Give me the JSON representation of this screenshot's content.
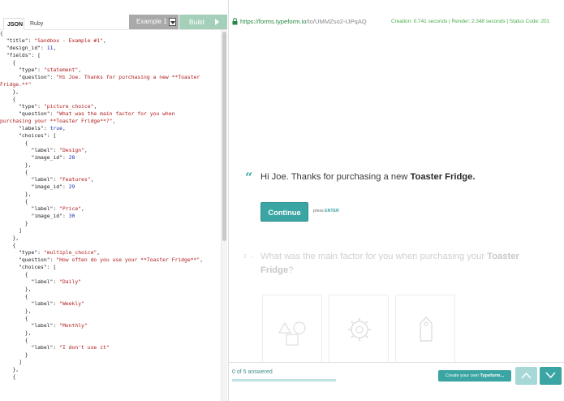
{
  "editor": {
    "tabs": [
      {
        "label": "JSON",
        "active": true
      },
      {
        "label": "Ruby",
        "active": false
      }
    ],
    "example_select": "Example 1",
    "build_label": "Build",
    "code_lines": [
      [
        [
          "k",
          "{"
        ]
      ],
      [
        [
          "k",
          "  \"title\": "
        ],
        [
          "s",
          "\"Sandbox - Example #1\""
        ],
        [
          "k",
          ","
        ]
      ],
      [
        [
          "k",
          "  \"design_id\": "
        ],
        [
          "n",
          "11"
        ],
        [
          "k",
          ","
        ]
      ],
      [
        [
          "k",
          "  \"fields\": ["
        ]
      ],
      [
        [
          "k",
          "    {"
        ]
      ],
      [
        [
          "k",
          "      \"type\": "
        ],
        [
          "s",
          "\"statement\""
        ],
        [
          "k",
          ","
        ]
      ],
      [
        [
          "k",
          "      \"question\": "
        ],
        [
          "s",
          "\"Hi Joe. Thanks for purchasing a new **Toaster"
        ]
      ],
      [
        [
          "s",
          "Fridge.**\""
        ]
      ],
      [
        [
          "k",
          "    },"
        ]
      ],
      [
        [
          "k",
          "    {"
        ]
      ],
      [
        [
          "k",
          "      \"type\": "
        ],
        [
          "s",
          "\"picture_choice\""
        ],
        [
          "k",
          ","
        ]
      ],
      [
        [
          "k",
          "      \"question\": "
        ],
        [
          "s",
          "\"What was the main factor for you when"
        ]
      ],
      [
        [
          "s",
          "purchasing your **Toaster Fridge**?\""
        ],
        [
          "k",
          ","
        ]
      ],
      [
        [
          "k",
          "      \"labels\": "
        ],
        [
          "n",
          "true"
        ],
        [
          "k",
          ","
        ]
      ],
      [
        [
          "k",
          "      \"choices\": ["
        ]
      ],
      [
        [
          "k",
          "        {"
        ]
      ],
      [
        [
          "k",
          "          \"label\": "
        ],
        [
          "s",
          "\"Design\""
        ],
        [
          "k",
          ","
        ]
      ],
      [
        [
          "k",
          "          \"image_id\": "
        ],
        [
          "n",
          "28"
        ]
      ],
      [
        [
          "k",
          "        },"
        ]
      ],
      [
        [
          "k",
          "        {"
        ]
      ],
      [
        [
          "k",
          "          \"label\": "
        ],
        [
          "s",
          "\"Features\""
        ],
        [
          "k",
          ","
        ]
      ],
      [
        [
          "k",
          "          \"image_id\": "
        ],
        [
          "n",
          "29"
        ]
      ],
      [
        [
          "k",
          "        },"
        ]
      ],
      [
        [
          "k",
          "        {"
        ]
      ],
      [
        [
          "k",
          "          \"label\": "
        ],
        [
          "s",
          "\"Price\""
        ],
        [
          "k",
          ","
        ]
      ],
      [
        [
          "k",
          "          \"image_id\": "
        ],
        [
          "n",
          "30"
        ]
      ],
      [
        [
          "k",
          "        }"
        ]
      ],
      [
        [
          "k",
          "      ]"
        ]
      ],
      [
        [
          "k",
          "    },"
        ]
      ],
      [
        [
          "k",
          "    {"
        ]
      ],
      [
        [
          "k",
          "      \"type\": "
        ],
        [
          "s",
          "\"multiple_choice\""
        ],
        [
          "k",
          ","
        ]
      ],
      [
        [
          "k",
          "      \"question\": "
        ],
        [
          "s",
          "\"How often do you use your **Toaster Fridge**\""
        ],
        [
          "k",
          ","
        ]
      ],
      [
        [
          "k",
          "      \"choices\": ["
        ]
      ],
      [
        [
          "k",
          "        {"
        ]
      ],
      [
        [
          "k",
          "          \"label\": "
        ],
        [
          "s",
          "\"Daily\""
        ]
      ],
      [
        [
          "k",
          "        },"
        ]
      ],
      [
        [
          "k",
          "        {"
        ]
      ],
      [
        [
          "k",
          "          \"label\": "
        ],
        [
          "s",
          "\"Weekly\""
        ]
      ],
      [
        [
          "k",
          "        },"
        ]
      ],
      [
        [
          "k",
          "        {"
        ]
      ],
      [
        [
          "k",
          "          \"label\": "
        ],
        [
          "s",
          "\"Monthly\""
        ]
      ],
      [
        [
          "k",
          "        },"
        ]
      ],
      [
        [
          "k",
          "        {"
        ]
      ],
      [
        [
          "k",
          "          \"label\": "
        ],
        [
          "s",
          "\"I don't use it\""
        ]
      ],
      [
        [
          "k",
          "        }"
        ]
      ],
      [
        [
          "k",
          "      ]"
        ]
      ],
      [
        [
          "k",
          "    },"
        ]
      ],
      [
        [
          "k",
          "    {"
        ]
      ]
    ]
  },
  "preview": {
    "url_scheme": "https://",
    "url_host": "forms.typeform.io",
    "url_path": "/to/UMMZso2-IJPqAQ",
    "timing": "Creation: 0.741 seconds | Render: 2.348 seconds | Status Code: 201",
    "statement_text": "Hi Joe. Thanks for purchasing a new ",
    "statement_bold": "Toaster Fridge.",
    "continue_label": "Continue",
    "press_label": "press ",
    "press_key": "ENTER",
    "next_number": "2 →",
    "next_question_text": "What was the main factor for you when purchasing your ",
    "next_question_bold": "Toaster Fridge",
    "next_question_end": "?",
    "progress_text": "0 of 5 answered",
    "progress_fraction": 0,
    "create_label": "Create your own ",
    "create_brand": "Typeform...",
    "icons": [
      "lock-icon",
      "quote-icon",
      "shapes-icon",
      "gear-icon",
      "tag-icon",
      "chevron-up-icon",
      "chevron-down-icon"
    ],
    "colors": {
      "accent": "#3aa5a3",
      "url_host": "#26883f",
      "timing": "#4aae4a",
      "build": "#a4d0ba"
    }
  }
}
